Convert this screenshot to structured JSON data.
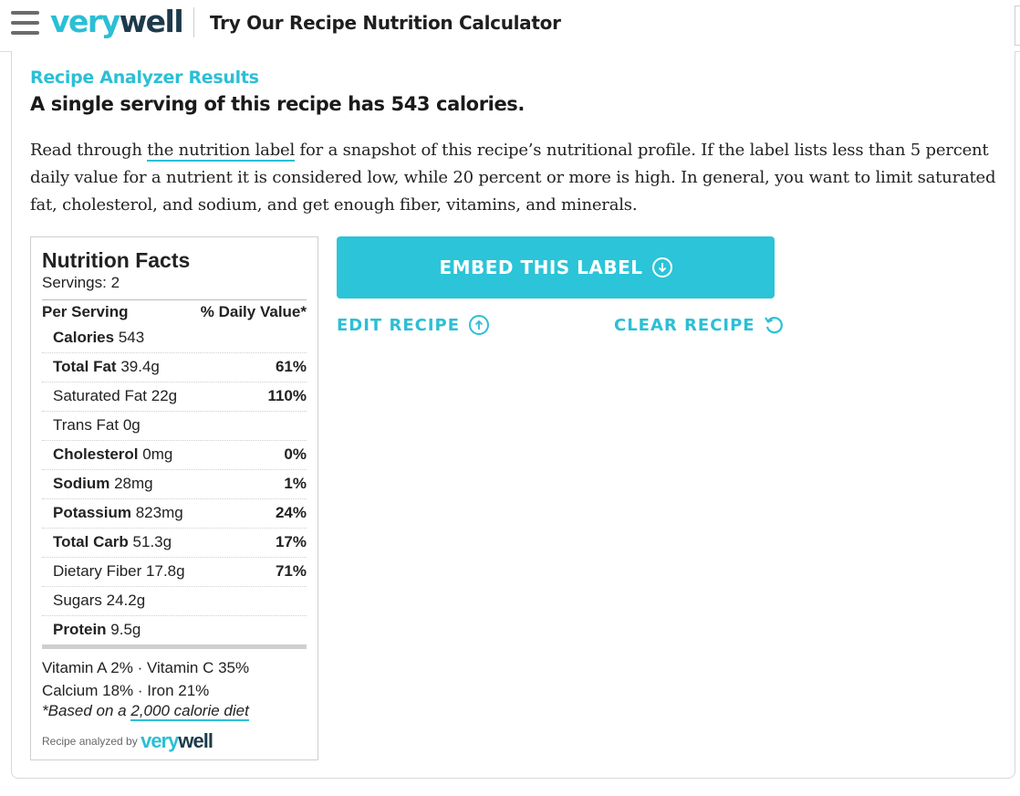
{
  "header": {
    "logo_part1": "very",
    "logo_part2": "well",
    "title": "Try Our Recipe Nutrition Calculator"
  },
  "results": {
    "heading": "Recipe Analyzer Results",
    "subheading": "A single serving of this recipe has 543 calories.",
    "intro_before": "Read through ",
    "intro_link": "the nutrition label",
    "intro_after": " for a snapshot of this recipe’s nutritional profile. If the label lists less than 5 percent daily value for a nutrient it is considered low, while 20 percent or more is high. In general, you want to limit saturated fat, cholesterol, and sodium, and get enough fiber, vitamins, and minerals."
  },
  "nutrition": {
    "title": "Nutrition Facts",
    "servings": "Servings: 2",
    "per_serving": "Per Serving",
    "daily_value": "% Daily Value*",
    "rows": [
      {
        "label": "Calories",
        "amount": "543",
        "pct": ""
      },
      {
        "label": "Total Fat",
        "amount": "39.4g",
        "pct": "61%"
      },
      {
        "label": "Saturated Fat",
        "amount": "22g",
        "pct": "110%"
      },
      {
        "label": "Trans Fat",
        "amount": "0g",
        "pct": ""
      },
      {
        "label": "Cholesterol",
        "amount": "0mg",
        "pct": "0%"
      },
      {
        "label": "Sodium",
        "amount": "28mg",
        "pct": "1%"
      },
      {
        "label": "Potassium",
        "amount": "823mg",
        "pct": "24%"
      },
      {
        "label": "Total Carb",
        "amount": "51.3g",
        "pct": "17%"
      },
      {
        "label": "Dietary Fiber",
        "amount": "17.8g",
        "pct": "71%"
      },
      {
        "label": "Sugars",
        "amount": "24.2g",
        "pct": ""
      },
      {
        "label": "Protein",
        "amount": "9.5g",
        "pct": ""
      }
    ],
    "vitamins_line1": "Vitamin A 2% · Vitamin C 35%",
    "vitamins_line2": "Calcium 18% · Iron 21%",
    "note_prefix": "*Based on a ",
    "note_link": "2,000 calorie diet",
    "analyzed_by": "Recipe analyzed by ",
    "analyzed_logo_part1": "very",
    "analyzed_logo_part2": "well"
  },
  "actions": {
    "embed_label": "EMBED THIS LABEL",
    "edit_label": "EDIT RECIPE",
    "clear_label": "CLEAR RECIPE"
  },
  "colors": {
    "accent": "#2bbfd5",
    "button": "#2bc4d8",
    "logo_dark": "#1d3a4c"
  }
}
